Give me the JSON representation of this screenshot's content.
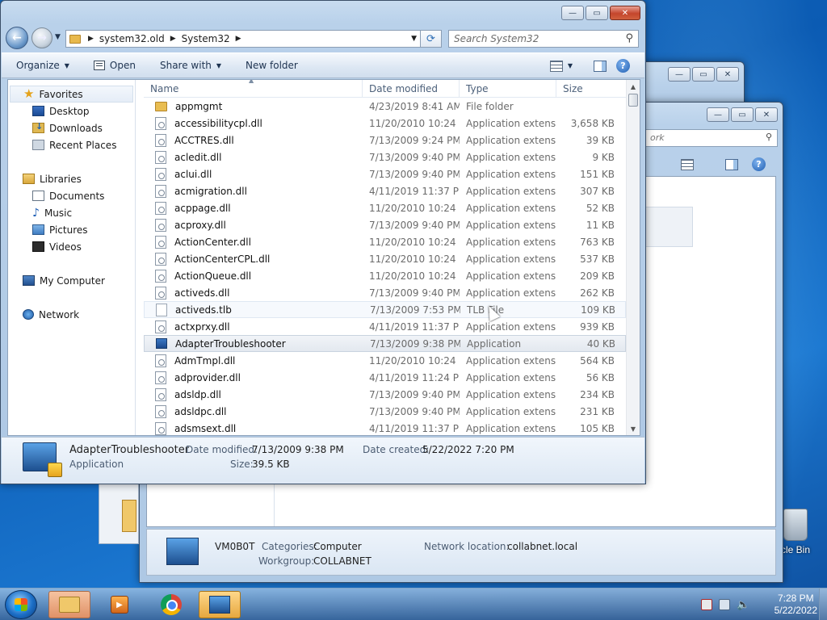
{
  "desktop": {
    "recycle_label": "cle Bin"
  },
  "back_window2": {
    "search_text": "ork",
    "status": {
      "name": "VM0B0T",
      "categories_label": "Categories:",
      "categories_value": "Computer",
      "workgroup_label": "Workgroup:",
      "workgroup_value": "COLLABNET",
      "netloc_label": "Network location:",
      "netloc_value": "collabnet.local"
    }
  },
  "window": {
    "min_glyph": "—",
    "max_glyph": "▭",
    "close_glyph": "✕"
  },
  "address": {
    "crumbs": [
      "system32.old",
      "System32"
    ],
    "search_placeholder": "Search System32"
  },
  "toolbar": {
    "organize": "Organize",
    "open": "Open",
    "share_with": "Share with",
    "new_folder": "New folder"
  },
  "nav": {
    "favorites": "Favorites",
    "desktop": "Desktop",
    "downloads": "Downloads",
    "recent": "Recent Places",
    "libraries": "Libraries",
    "documents": "Documents",
    "music": "Music",
    "pictures": "Pictures",
    "videos": "Videos",
    "computer": "My Computer",
    "network": "Network"
  },
  "columns": {
    "name": "Name",
    "date": "Date modified",
    "type": "Type",
    "size": "Size"
  },
  "files": [
    {
      "name": "appmgmt",
      "date": "4/23/2019 8:41 AM",
      "type": "File folder",
      "size": "",
      "kind": "folder"
    },
    {
      "name": "accessibilitycpl.dll",
      "date": "11/20/2010 10:24 ...",
      "type": "Application extens...",
      "size": "3,658 KB",
      "kind": "dll"
    },
    {
      "name": "ACCTRES.dll",
      "date": "7/13/2009 9:24 PM",
      "type": "Application extens...",
      "size": "39 KB",
      "kind": "dll"
    },
    {
      "name": "acledit.dll",
      "date": "7/13/2009 9:40 PM",
      "type": "Application extens...",
      "size": "9 KB",
      "kind": "dll"
    },
    {
      "name": "aclui.dll",
      "date": "7/13/2009 9:40 PM",
      "type": "Application extens...",
      "size": "151 KB",
      "kind": "dll"
    },
    {
      "name": "acmigration.dll",
      "date": "4/11/2019 11:37 PM",
      "type": "Application extens...",
      "size": "307 KB",
      "kind": "dll"
    },
    {
      "name": "acppage.dll",
      "date": "11/20/2010 10:24 ...",
      "type": "Application extens...",
      "size": "52 KB",
      "kind": "dll"
    },
    {
      "name": "acproxy.dll",
      "date": "7/13/2009 9:40 PM",
      "type": "Application extens...",
      "size": "11 KB",
      "kind": "dll"
    },
    {
      "name": "ActionCenter.dll",
      "date": "11/20/2010 10:24 ...",
      "type": "Application extens...",
      "size": "763 KB",
      "kind": "dll"
    },
    {
      "name": "ActionCenterCPL.dll",
      "date": "11/20/2010 10:24 ...",
      "type": "Application extens...",
      "size": "537 KB",
      "kind": "dll"
    },
    {
      "name": "ActionQueue.dll",
      "date": "11/20/2010 10:24 ...",
      "type": "Application extens...",
      "size": "209 KB",
      "kind": "dll"
    },
    {
      "name": "activeds.dll",
      "date": "7/13/2009 9:40 PM",
      "type": "Application extens...",
      "size": "262 KB",
      "kind": "dll"
    },
    {
      "name": "activeds.tlb",
      "date": "7/13/2009 7:53 PM",
      "type": "TLB File",
      "size": "109 KB",
      "kind": "tlb",
      "state": "hover"
    },
    {
      "name": "actxprxy.dll",
      "date": "4/11/2019 11:37 PM",
      "type": "Application extens...",
      "size": "939 KB",
      "kind": "dll"
    },
    {
      "name": "AdapterTroubleshooter",
      "date": "7/13/2009 9:38 PM",
      "type": "Application",
      "size": "40 KB",
      "kind": "app",
      "state": "sel"
    },
    {
      "name": "AdmTmpl.dll",
      "date": "11/20/2010 10:24 ...",
      "type": "Application extens...",
      "size": "564 KB",
      "kind": "dll"
    },
    {
      "name": "adprovider.dll",
      "date": "4/11/2019 11:24 PM",
      "type": "Application extens...",
      "size": "56 KB",
      "kind": "dll"
    },
    {
      "name": "adsldp.dll",
      "date": "7/13/2009 9:40 PM",
      "type": "Application extens...",
      "size": "234 KB",
      "kind": "dll"
    },
    {
      "name": "adsldpc.dll",
      "date": "7/13/2009 9:40 PM",
      "type": "Application extens...",
      "size": "231 KB",
      "kind": "dll"
    },
    {
      "name": "adsmsext.dll",
      "date": "4/11/2019 11:37 PM",
      "type": "Application extens...",
      "size": "105 KB",
      "kind": "dll"
    }
  ],
  "details": {
    "name": "AdapterTroubleshooter",
    "type": "Application",
    "modified_label": "Date modified:",
    "modified_value": "7/13/2009 9:38 PM",
    "created_label": "Date created:",
    "created_value": "5/22/2022 7:20 PM",
    "size_label": "Size:",
    "size_value": "39.5 KB"
  },
  "taskbar": {
    "time": "7:28 PM",
    "date": "5/22/2022"
  }
}
